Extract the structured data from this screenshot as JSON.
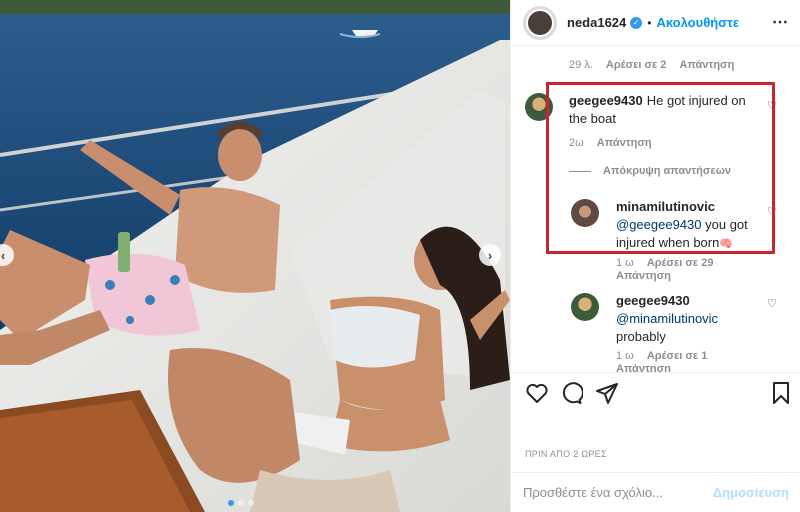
{
  "photo": {
    "description_icon": "photo-post",
    "carousel_prev_glyph": "‹",
    "carousel_next_glyph": "›",
    "dots_count": 3,
    "active_dot": 0
  },
  "header": {
    "username": "neda1624",
    "verified_glyph": "✓",
    "separator": "•",
    "follow_label": "Ακολουθήστε",
    "more_glyph": "⋯"
  },
  "comments": {
    "top_meta": {
      "age": "29 λ.",
      "likes": "Αρέσει σε 2",
      "reply": "Απάντηση"
    },
    "main_comment": {
      "username": "geegee9430",
      "text_line1": "He got injured on",
      "text_line2": "the boat",
      "age": "2ω",
      "reply": "Απάντηση"
    },
    "hide_replies_label": "Απόκρυψη απαντήσεων",
    "reply1": {
      "username": "minamilutinovic",
      "mention": "@geegee9430",
      "text_part1": "you got",
      "text_part2": "injured when born",
      "emoji": "🧠",
      "age": "1 ω",
      "likes": "Αρέσει σε 29",
      "reply": "Απάντηση"
    },
    "reply2": {
      "username": "geegee9430",
      "mention": "@minamilutinovic",
      "text": "probably",
      "age": "1 ω",
      "likes": "Αρέσει σε 1",
      "reply": "Απάντηση"
    }
  },
  "actions": {
    "like_icon": "heart-outline",
    "comment_icon": "speech-bubble",
    "share_icon": "paper-plane",
    "save_icon": "bookmark"
  },
  "timestamp": "ΠΡΙΝ ΑΠΟ 2 ΩΡΕΣ",
  "add_comment": {
    "placeholder": "Προσθέστε ένα σχόλιο...",
    "post_label": "Δημοσίευση"
  },
  "colors": {
    "accent": "#0095f6",
    "highlight_border": "#c8262e",
    "post_disabled": "#b2dffc",
    "meta_gray": "#8e8e8e"
  }
}
